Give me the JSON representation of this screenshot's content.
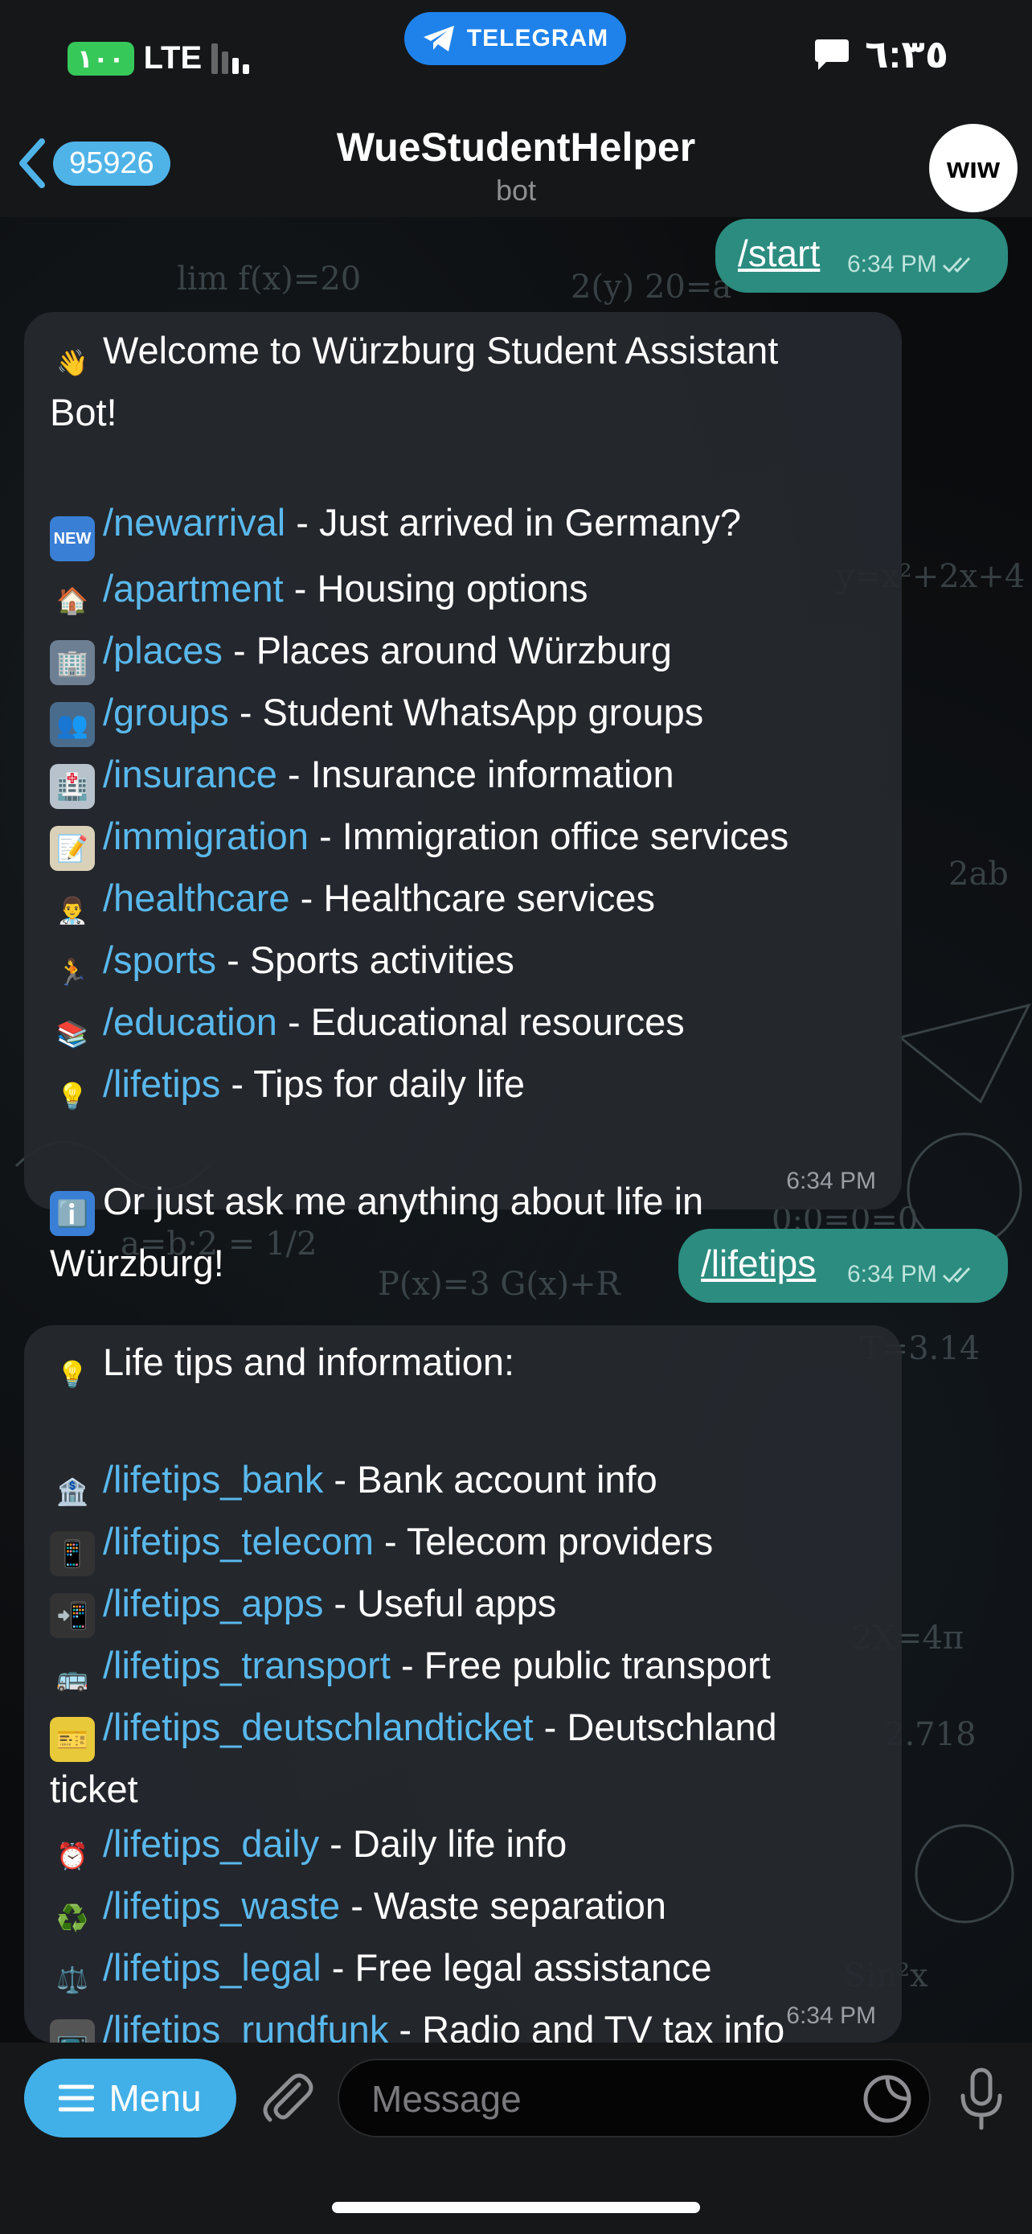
{
  "status_bar": {
    "battery": "١٠٠",
    "network": "LTE",
    "telegram_pill": "TELEGRAM",
    "time": "٦:٣٥"
  },
  "header": {
    "back_count": "95926",
    "title": "WueStudentHelper",
    "subtitle": "bot",
    "avatar_text": "wıw"
  },
  "messages": {
    "start": {
      "text": "/start",
      "time": "6:34 PM"
    },
    "welcome": {
      "title_emoji": "👋",
      "title_line1": "Welcome to Würzburg Student Assistant",
      "title_line2": "Bot!",
      "items": [
        {
          "icon": "new-icon",
          "emoji": "NEW",
          "cmd": "/newarrival",
          "desc": " - Just arrived in Germany?"
        },
        {
          "icon": "house-icon",
          "emoji": "🏠",
          "cmd": "/apartment",
          "desc": " - Housing options"
        },
        {
          "icon": "office-building-icon",
          "emoji": "🏢",
          "cmd": "/places",
          "desc": " - Places around Würzburg"
        },
        {
          "icon": "people-icon",
          "emoji": "👥",
          "cmd": "/groups",
          "desc": " - Student WhatsApp groups"
        },
        {
          "icon": "hospital-icon",
          "emoji": "🏥",
          "cmd": "/insurance",
          "desc": " - Insurance information"
        },
        {
          "icon": "memo-icon",
          "emoji": "📝",
          "cmd": "/immigration",
          "desc": " - Immigration office services"
        },
        {
          "icon": "doctor-icon",
          "emoji": "👨‍⚕️",
          "cmd": "/healthcare",
          "desc": " - Healthcare services"
        },
        {
          "icon": "runner-icon",
          "emoji": "🏃",
          "cmd": "/sports",
          "desc": " - Sports activities"
        },
        {
          "icon": "books-icon",
          "emoji": "📚",
          "cmd": "/education",
          "desc": " - Educational resources"
        },
        {
          "icon": "lightbulb-icon",
          "emoji": "💡",
          "cmd": "/lifetips",
          "desc": " - Tips for daily life"
        }
      ],
      "footer_emoji": "ℹ️",
      "footer_line1": "Or just ask me anything about life in",
      "footer_line2": "Würzburg!",
      "time": "6:34 PM"
    },
    "lifetips_cmd": {
      "text": "/lifetips",
      "time": "6:34 PM"
    },
    "lifetips": {
      "title_emoji": "💡",
      "title": "Life tips and information:",
      "items": [
        {
          "icon": "bank-icon",
          "emoji": "🏦",
          "cmd": "/lifetips_bank",
          "desc": " - Bank account info"
        },
        {
          "icon": "phone-icon",
          "emoji": "📱",
          "cmd": "/lifetips_telecom",
          "desc": " - Telecom providers"
        },
        {
          "icon": "phone-arrow-icon",
          "emoji": "📲",
          "cmd": "/lifetips_apps",
          "desc": " - Useful apps"
        },
        {
          "icon": "bus-icon",
          "emoji": "🚌",
          "cmd": "/lifetips_transport",
          "desc": " - Free public transport"
        },
        {
          "icon": "ticket-icon",
          "emoji": "🎫",
          "cmd": "/lifetips_deutschlandticket",
          "desc": " - Deutschland",
          "wrap": "ticket"
        },
        {
          "icon": "alarm-clock-icon",
          "emoji": "⏰",
          "cmd": "/lifetips_daily",
          "desc": " - Daily life info"
        },
        {
          "icon": "recycle-icon",
          "emoji": "♻️",
          "cmd": "/lifetips_waste",
          "desc": " - Waste separation"
        },
        {
          "icon": "scales-icon",
          "emoji": "⚖️",
          "cmd": "/lifetips_legal",
          "desc": " - Free legal assistance"
        },
        {
          "icon": "tv-icon",
          "emoji": "📺",
          "cmd": "/lifetips_rundfunk",
          "desc": " - Radio and TV tax info"
        }
      ],
      "time": "6:34 PM"
    }
  },
  "input_bar": {
    "menu_label": "Menu",
    "placeholder": "Message"
  },
  "colors": {
    "outgoing_bubble": "#2b8c7f",
    "incoming_bubble": "#26292e",
    "link": "#5ab8ec",
    "accent": "#42b0e8"
  }
}
